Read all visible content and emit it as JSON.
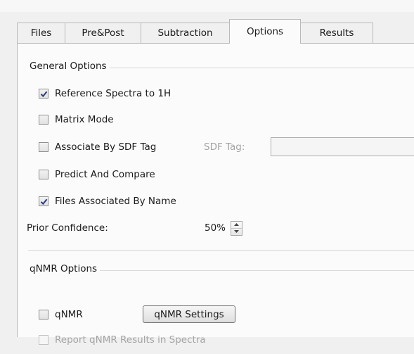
{
  "tabs": [
    {
      "label": "Files",
      "active": false
    },
    {
      "label": "Pre&Post",
      "active": false
    },
    {
      "label": "Subtraction",
      "active": false
    },
    {
      "label": "Options",
      "active": true
    },
    {
      "label": "Results",
      "active": false
    }
  ],
  "general_options": {
    "title": "General Options",
    "reference_spectra": {
      "label": "Reference Spectra to 1H",
      "checked": true
    },
    "matrix_mode": {
      "label": "Matrix Mode",
      "checked": false
    },
    "associate_by_sdf": {
      "label": "Associate By SDF Tag",
      "checked": false
    },
    "sdf_tag_label": "SDF Tag:",
    "sdf_tag_value": "",
    "predict_and_compare": {
      "label": "Predict And Compare",
      "checked": false
    },
    "files_associated": {
      "label": "Files Associated By Name",
      "checked": true
    },
    "prior_confidence_label": "Prior Confidence:",
    "prior_confidence_value": "50%"
  },
  "qnmr_options": {
    "title": "qNMR Options",
    "qnmr": {
      "label": "qNMR",
      "checked": false
    },
    "settings_button": "qNMR Settings",
    "report_results": {
      "label": "Report qNMR Results in Spectra",
      "checked": false,
      "disabled": true
    }
  }
}
